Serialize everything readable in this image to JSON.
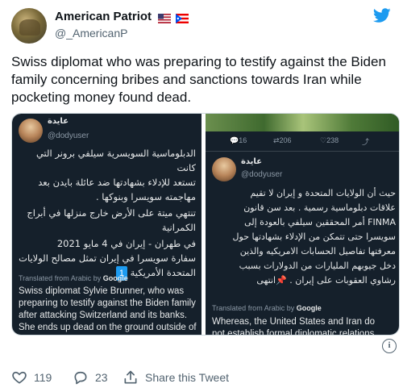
{
  "author": {
    "display_name": "American Patriot",
    "handle": "@_AmericanP",
    "flags": [
      "us-flag-icon",
      "puerto-rico-flag-icon"
    ]
  },
  "tweet": {
    "text": "Swiss diplomat who was preparing to testify against the Biden family concerning bribes and sanctions towards Iran while pocketing money found dead."
  },
  "media": {
    "left": {
      "name": "عايدة",
      "handle": "@dodyuser",
      "arabic_lines": [
        "الدبلوماسية السويسرية سيلفي برونر التي كانت",
        "تستعد للإدلاء بشهادتها ضد عائلة بايدن بعد",
        "مهاجمته سويسرا وبنوكها .",
        "تنتهي ميتة على الأرض خارج منزلها في أبراج",
        "الكمرانية",
        "في طهران - إيران في 4 مايو 2021",
        "سفارة سويسرا في إيران تمثل مصالح الولايات",
        "المتحدة الأمريكية"
      ],
      "badge": "1",
      "translated_label": "Translated from Arabic by",
      "translated_brand": "Google",
      "english_lines": [
        "Swiss diplomat Sylvie Brunner, who was",
        "preparing to testify against the Biden family",
        "after attacking Switzerland and its banks.",
        "She ends up dead on the ground outside of"
      ]
    },
    "right": {
      "stats": {
        "replies": "16",
        "retweets": "206",
        "likes": "238"
      },
      "name": "عايدة",
      "handle": "@dodyuser",
      "arabic_lines": [
        "حيث أن الولايات المتحدة و إيران لا تقيم",
        "علاقات دبلوماسية رسمية . بعد سن قانون",
        "FINMA أمر المحققين سيلفي بالعودة إلى",
        "سويسرا حتى تتمكن من الإدلاء بشهادتها حول",
        "معرفتها تفاصيل الحسابات الامريكيه والذين",
        "دخل جيوبهم المليارات من الدولارات بسبب",
        "رشاوي العقوبات على إيران . 📌انتهى"
      ],
      "translated_label": "Translated from Arabic by",
      "translated_brand": "Google",
      "english_lines": [
        "Whereas, the United States and Iran do",
        "not establish formal diplomatic relations."
      ]
    }
  },
  "actions": {
    "likes": "119",
    "replies": "23",
    "share_label": "Share this Tweet"
  },
  "colors": {
    "twitter_blue": "#1d9bf0",
    "dark_bg": "#15202b",
    "muted": "#536471"
  }
}
